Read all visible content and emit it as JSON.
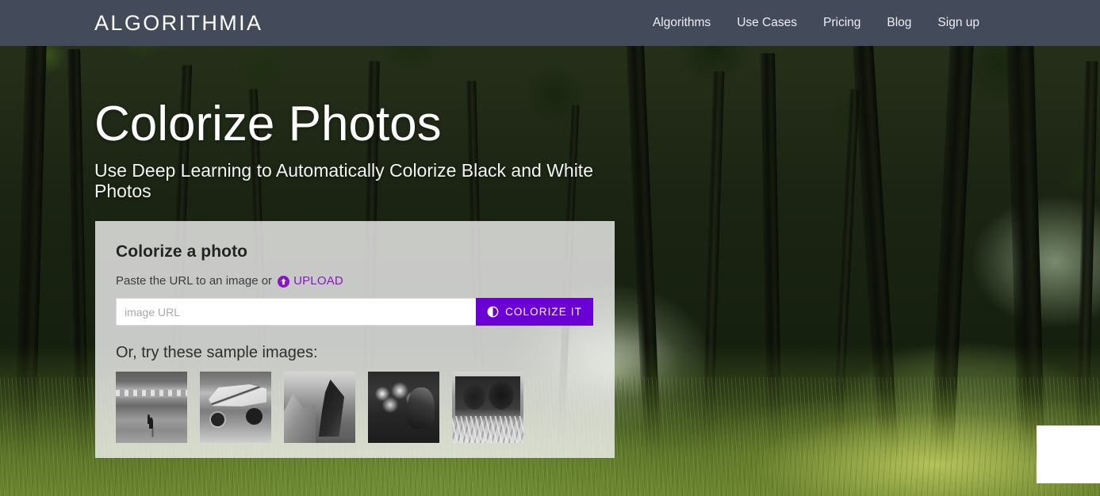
{
  "header": {
    "brand": "ALGORITHMIA",
    "nav": [
      {
        "label": "Algorithms"
      },
      {
        "label": "Use Cases"
      },
      {
        "label": "Pricing"
      },
      {
        "label": "Blog"
      },
      {
        "label": "Sign up"
      }
    ]
  },
  "hero": {
    "title": "Colorize Photos",
    "subtitle": "Use Deep Learning to Automatically Colorize Black and White Photos"
  },
  "card": {
    "title": "Colorize a photo",
    "instruction": "Paste the URL to an image or",
    "upload_label": "UPLOAD",
    "upload_icon": "upload-circle-icon",
    "input": {
      "value": "",
      "placeholder": "image URL"
    },
    "submit_label": "COLORIZE IT",
    "submit_icon": "contrast-circle-icon",
    "samples_title": "Or, try these sample images:",
    "samples": [
      {
        "name": "bird-on-beach"
      },
      {
        "name": "race-car"
      },
      {
        "name": "mountain-peak"
      },
      {
        "name": "smoke-portrait"
      },
      {
        "name": "cows-in-grass"
      }
    ]
  },
  "colors": {
    "header_bg": "#434a59",
    "accent_purple": "#6b00d4",
    "upload_link": "#8a14c8",
    "card_bg": "rgba(244,244,244,0.80)",
    "text_light": "#ffffff",
    "text_dark": "#222426"
  },
  "widget": {
    "name": "support-widget-placeholder"
  }
}
